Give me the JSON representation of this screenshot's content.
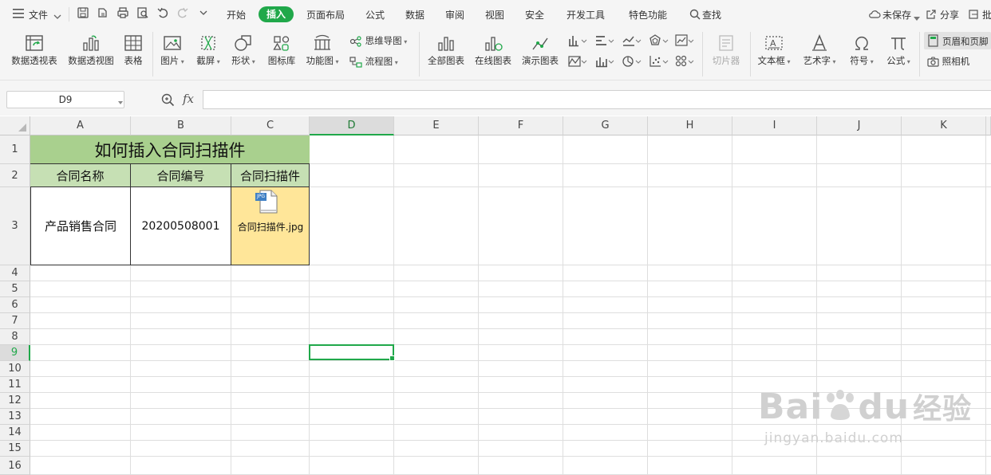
{
  "menu": {
    "file": "文件",
    "tabs": [
      "开始",
      "插入",
      "页面布局",
      "公式",
      "数据",
      "审阅",
      "视图",
      "安全",
      "开发工具",
      "特色功能"
    ],
    "active_tab": "插入",
    "search": "查找",
    "unsaved": "未保存",
    "share": "分享",
    "batch": "批"
  },
  "ribbon": {
    "pivot_table": "数据透视表",
    "pivot_chart": "数据透视图",
    "table": "表格",
    "picture": "图片",
    "screenshot": "截屏",
    "shape": "形状",
    "icon_lib": "图标库",
    "func_chart": "功能图",
    "mind_map": "思维导图",
    "flowchart": "流程图",
    "all_charts": "全部图表",
    "online_chart": "在线图表",
    "demo_chart": "演示图表",
    "slicer": "切片器",
    "textbox": "文本框",
    "wordart": "艺术字",
    "symbol": "符号",
    "formula": "公式",
    "header_footer": "页眉和页脚",
    "camera": "照相机"
  },
  "formula_bar": {
    "cell_ref": "D9",
    "fx": "fx"
  },
  "sheet": {
    "columns": [
      "A",
      "B",
      "C",
      "D",
      "E",
      "F",
      "G",
      "H",
      "I",
      "J",
      "K"
    ],
    "selected_column": "D",
    "rows": [
      "1",
      "2",
      "3",
      "4",
      "5",
      "6",
      "7",
      "8",
      "9",
      "10",
      "11",
      "12",
      "13",
      "14",
      "15",
      "16"
    ],
    "selected_row": "9",
    "title": "如何插入合同扫描件",
    "headers": [
      "合同名称",
      "合同编号",
      "合同扫描件"
    ],
    "row3": {
      "name": "产品销售合同",
      "number": "20200508001",
      "attachment": "合同扫描件.jpg",
      "attachment_badge": "JPG"
    },
    "title_fill": "#a9d08e",
    "header_fill": "#c6e0b4",
    "attachment_fill": "#ffe699",
    "selection_color": "#20a84a"
  },
  "watermark": {
    "brand": "Bai",
    "brand2": "du",
    "brand_cn": "经验",
    "url": "jingyan.baidu.com"
  }
}
